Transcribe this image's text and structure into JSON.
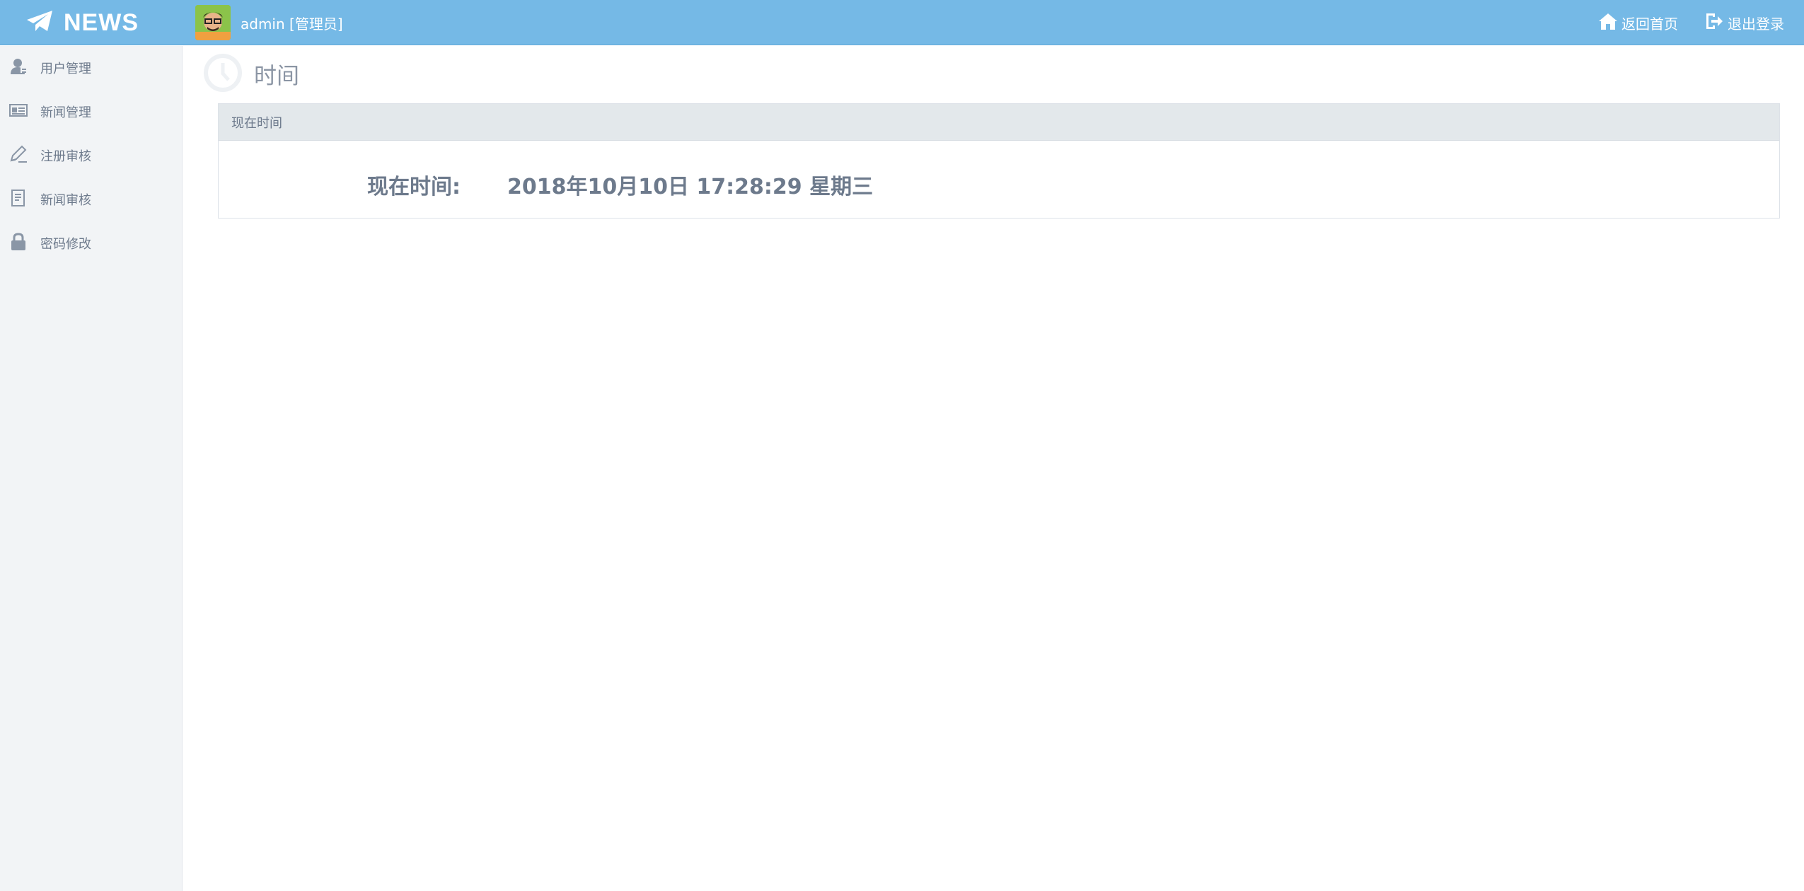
{
  "header": {
    "brand": "NEWS",
    "user_label": "admin [管理员]",
    "home_link": "返回首页",
    "logout_link": "退出登录"
  },
  "sidebar": {
    "items": [
      {
        "label": "用户管理",
        "icon": "user-icon"
      },
      {
        "label": "新闻管理",
        "icon": "newspaper-icon"
      },
      {
        "label": "注册审核",
        "icon": "pencil-icon"
      },
      {
        "label": "新闻审核",
        "icon": "document-icon"
      },
      {
        "label": "密码修改",
        "icon": "lock-icon"
      }
    ]
  },
  "main": {
    "page_title": "时间",
    "panel": {
      "title": "现在时间",
      "time_label": "现在时间:",
      "time_value": "2018年10月10日 17:28:29 星期三"
    }
  },
  "colors": {
    "topbar": "#75b9e6",
    "sidebar": "#f2f4f6",
    "panel_header": "#e3e8eb",
    "text": "#6d7a8c"
  }
}
